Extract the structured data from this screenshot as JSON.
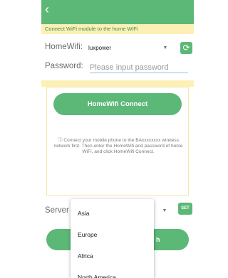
{
  "header": {
    "back_icon": "back-chevron-icon"
  },
  "notice": {
    "text": "Connect WiFi module to the home WiFi"
  },
  "home_wifi": {
    "label": "HomeWifi:",
    "value": "luxpower",
    "dropdown_icon": "chevron-down-icon",
    "refresh_icon": "refresh-icon"
  },
  "password": {
    "label": "Password:",
    "placeholder": "Please input password"
  },
  "panel": {
    "connect_label": "HomeWifi Connect",
    "info_icon": "info-icon",
    "info_text": "Connect your mobile phone to the BAxxxxxxxx wireless network first. Then enter the HomeWifi and password of home WiFi, and click HomeWifi Connect."
  },
  "server": {
    "label": "Server",
    "dropdown_icon": "chevron-down-icon",
    "set_label": "SET"
  },
  "second_button": {
    "visible_text": "h"
  },
  "server_options": [
    "Asia",
    "Europe",
    "Africa",
    "North America"
  ],
  "colors": {
    "accent": "#5cb877",
    "notice_bg": "#fcf0b6",
    "notice_text": "#3d8a53"
  }
}
